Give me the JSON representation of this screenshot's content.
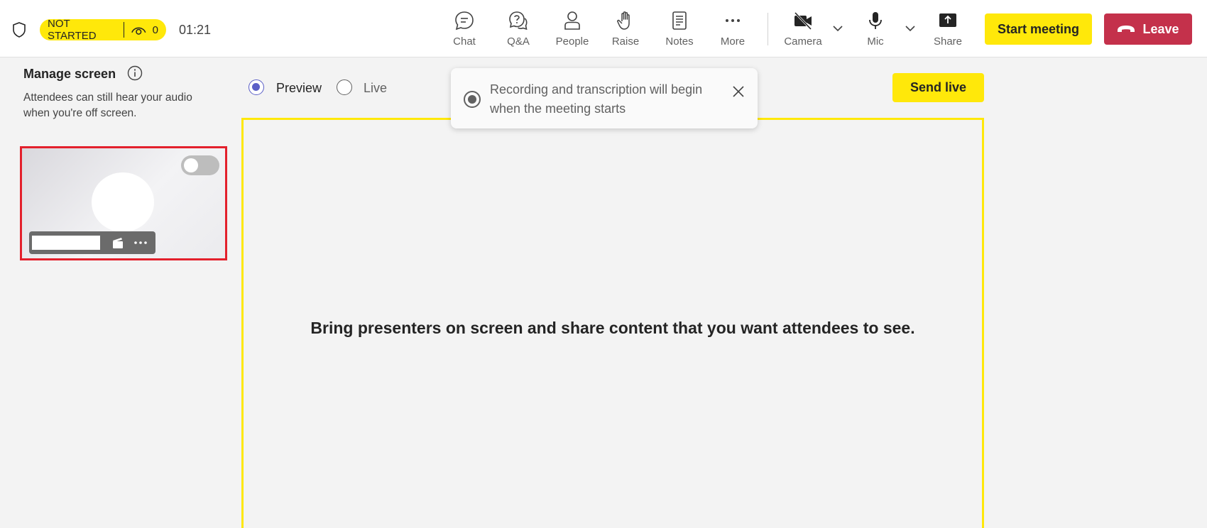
{
  "header": {
    "status": "NOT STARTED",
    "viewer_count": "0",
    "timer": "01:21",
    "toolbar": [
      {
        "id": "chat",
        "label": "Chat",
        "icon": "chat-icon"
      },
      {
        "id": "qa",
        "label": "Q&A",
        "icon": "qa-icon"
      },
      {
        "id": "people",
        "label": "People",
        "icon": "people-icon"
      },
      {
        "id": "raise",
        "label": "Raise",
        "icon": "raise-hand-icon"
      },
      {
        "id": "notes",
        "label": "Notes",
        "icon": "notes-icon"
      },
      {
        "id": "more",
        "label": "More",
        "icon": "more-icon"
      },
      {
        "id": "camera",
        "label": "Camera",
        "icon": "camera-off-icon"
      },
      {
        "id": "mic",
        "label": "Mic",
        "icon": "mic-icon"
      },
      {
        "id": "share",
        "label": "Share",
        "icon": "share-icon"
      }
    ],
    "start_meeting_label": "Start meeting",
    "leave_label": "Leave"
  },
  "sidebar": {
    "title": "Manage screen",
    "description": "Attendees can still hear your audio when you're off screen."
  },
  "main": {
    "preview_label": "Preview",
    "live_label": "Live",
    "selected_mode": "Preview",
    "send_live_label": "Send live",
    "stage_message": "Bring presenters on screen and share content that you want attendees to see."
  },
  "toast": {
    "message": "Recording and transcription will begin when the meeting starts"
  },
  "colors": {
    "accent_yellow": "#ffe80a",
    "leave_red": "#c4314b",
    "radio_purple": "#5b5fc7",
    "card_outline": "#e3202c"
  }
}
